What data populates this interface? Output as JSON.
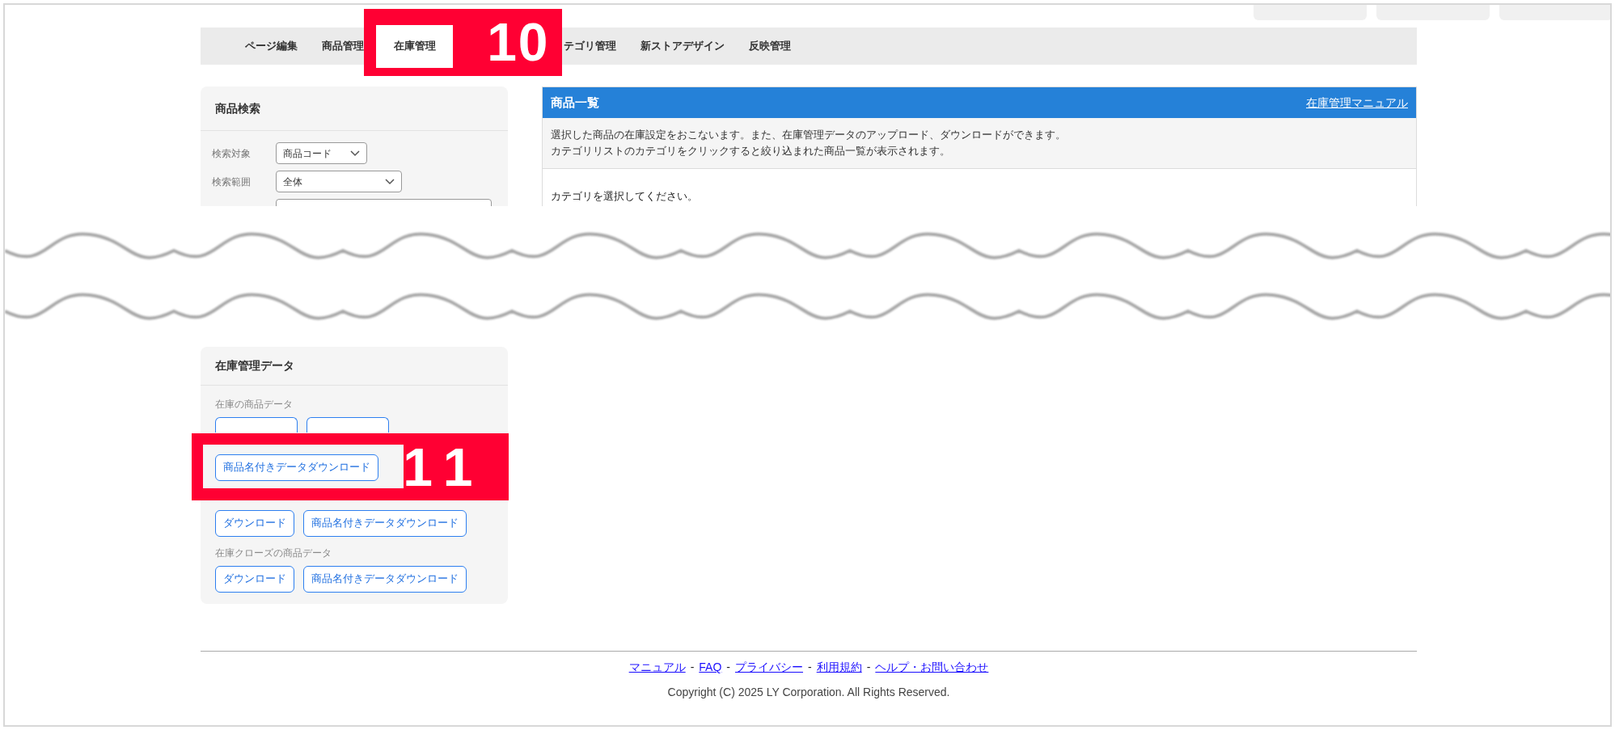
{
  "nav": {
    "tabs": [
      {
        "label": "ページ編集",
        "selected": false
      },
      {
        "label": "商品管理",
        "selected": false
      },
      {
        "label": "在庫管理",
        "selected": true
      },
      {
        "label": "テゴリ管理",
        "selected": false
      },
      {
        "label": "新ストアデザイン",
        "selected": false
      },
      {
        "label": "反映管理",
        "selected": false
      }
    ]
  },
  "callouts": [
    {
      "label": "10"
    },
    {
      "label": "11"
    }
  ],
  "search_panel": {
    "title": "商品検索",
    "fields": [
      {
        "label": "検索対象",
        "value": "商品コード"
      },
      {
        "label": "検索範囲",
        "value": "全体"
      }
    ]
  },
  "product_panel": {
    "title": "商品一覧",
    "manual_link": "在庫管理マニュアル",
    "description": [
      "選択した商品の在庫設定をおこないます。また、在庫管理データのアップロード、ダウンロードができます。",
      "カテゴリリストのカテゴリをクリックすると絞り込まれた商品一覧が表示されます。"
    ],
    "message": "カテゴリを選択してください。"
  },
  "data_panel": {
    "title": "在庫管理データ",
    "sections": [
      {
        "label": "在庫の商品データ",
        "buttons": [
          {
            "kind": "covered"
          },
          {
            "kind": "covered"
          },
          {
            "kind": "button",
            "label": "商品名付きデータダウンロード"
          }
        ]
      },
      {
        "buttons": [
          {
            "kind": "button",
            "label": "ダウンロード"
          },
          {
            "kind": "button",
            "label": "商品名付きデータダウンロード"
          }
        ]
      },
      {
        "label": "在庫クローズの商品データ",
        "buttons": [
          {
            "kind": "button",
            "label": "ダウンロード"
          },
          {
            "kind": "button",
            "label": "商品名付きデータダウンロード"
          }
        ]
      }
    ]
  },
  "footer": {
    "links": [
      "マニュアル",
      "FAQ",
      "プライバシー",
      "利用規約",
      "ヘルプ・お問い合わせ"
    ],
    "separator": "-",
    "copyright": "Copyright (C) 2025 LY Corporation. All Rights Reserved."
  }
}
